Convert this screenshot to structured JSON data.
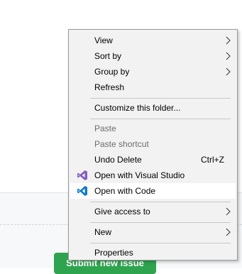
{
  "background": {
    "submit_button_label": "Submit new issue"
  },
  "menu": {
    "items": [
      {
        "label": "View"
      },
      {
        "label": "Sort by"
      },
      {
        "label": "Group by"
      },
      {
        "label": "Refresh"
      },
      {
        "label": "Customize this folder..."
      },
      {
        "label": "Paste"
      },
      {
        "label": "Paste shortcut"
      },
      {
        "label": "Undo Delete",
        "shortcut": "Ctrl+Z"
      },
      {
        "label": "Open with Visual Studio",
        "icon": "visual-studio-icon"
      },
      {
        "label": "Open with Code",
        "icon": "vscode-icon"
      },
      {
        "label": "Give access to"
      },
      {
        "label": "New"
      },
      {
        "label": "Properties"
      }
    ]
  },
  "colors": {
    "menu_bg": "#f2f2f2",
    "highlight": "#ffffff",
    "visual_studio_purple": "#865fc5",
    "vscode_blue": "#0078d4",
    "submit_green": "#2ea44f"
  }
}
